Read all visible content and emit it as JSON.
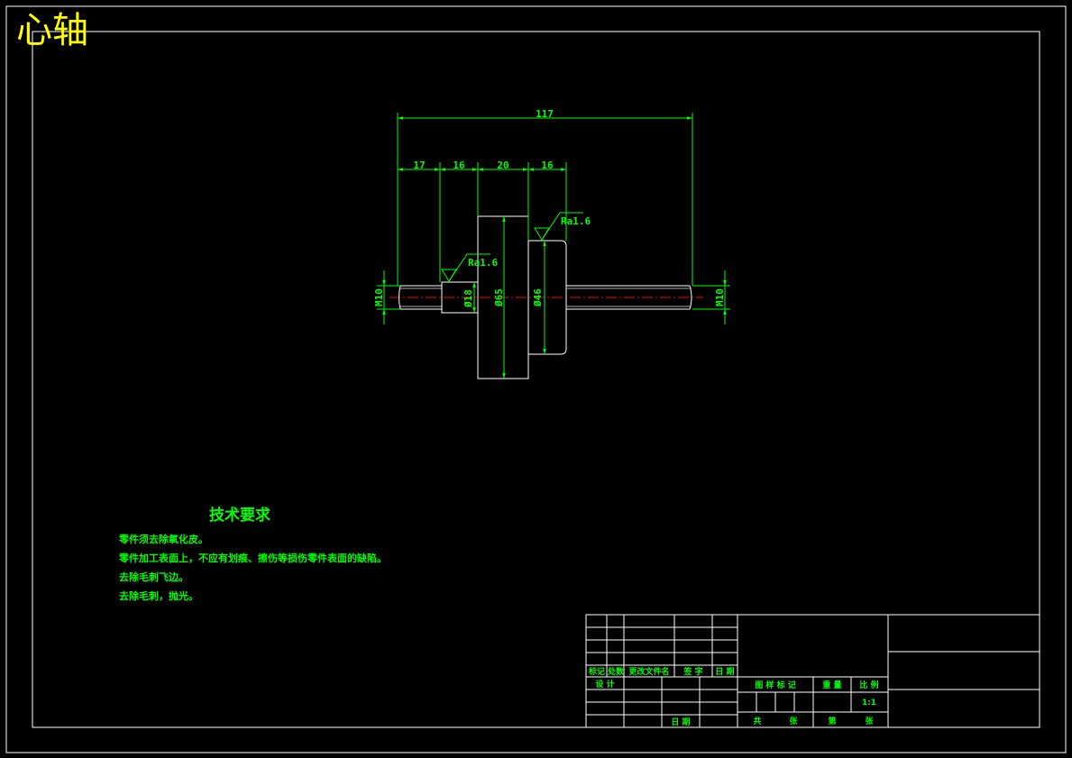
{
  "title": "心轴",
  "dimensions": {
    "overall": "117",
    "seg1": "17",
    "seg2": "16",
    "seg3": "20",
    "seg4": "16",
    "thread_left": "M10",
    "thread_right": "M10",
    "dia_small": "Ø18",
    "dia_large": "Ø65",
    "dia_mid": "Ø46"
  },
  "roughness": {
    "r1": "Ra1.6",
    "r2": "Ra1.6"
  },
  "tech_requirements": {
    "heading": "技术要求",
    "items": [
      "零件须去除氧化皮。",
      "零件加工表面上，不应有划痕、擦伤等损伤零件表面的缺陷。",
      "去除毛刺飞边。",
      "去除毛刺，抛光。"
    ]
  },
  "title_block": {
    "col_mark": "标记",
    "col_count": "处数",
    "col_docno": "更改文件名",
    "col_sign": "签 字",
    "col_date": "日 期",
    "designer": "设 计",
    "date2": "日 期",
    "stage_mark": "图 样 标 记",
    "weight": "重 量",
    "scale_label": "比 例",
    "scale_value": "1:1",
    "sheet_total": "共",
    "sheet_unit": "张",
    "sheet_no": "第",
    "sheet_unit2": "张"
  },
  "colors": {
    "outline": "#ffffff",
    "dimension": "#00ff00",
    "centerline": "#ff0000",
    "title": "#ffff00"
  }
}
